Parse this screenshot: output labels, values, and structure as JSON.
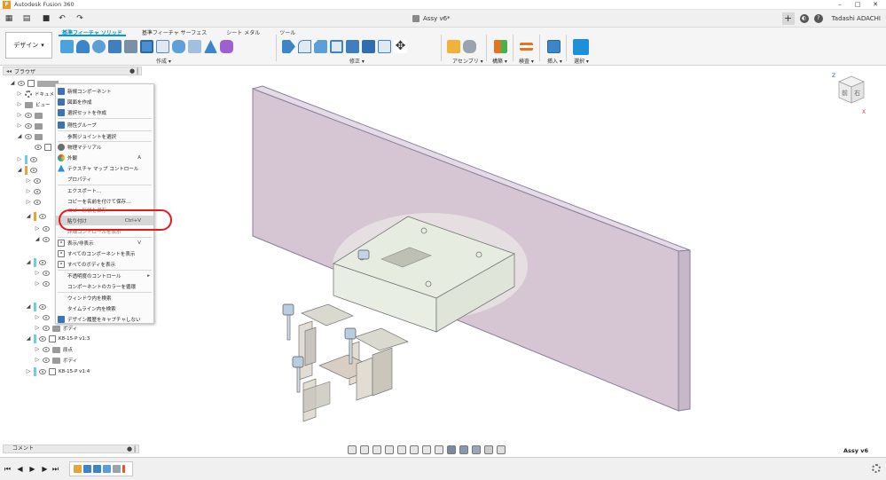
{
  "app": {
    "title": "Autodesk Fusion 360",
    "logo_letter": "F"
  },
  "window_controls": {
    "minimize": "–",
    "maximize": "□",
    "close": "✕"
  },
  "quick_access": {
    "grid_icon": "▦",
    "file_icon": "▤",
    "save_icon": "■",
    "undo_icon": "↶",
    "redo_icon": "↷",
    "document_tab": "Assy v6*",
    "tab_close": "✕",
    "new_tab": "+",
    "user": "Tadashi ADACHI",
    "help_badge": "?",
    "jobs_badge": "◐"
  },
  "toolbar": {
    "workspace": "デザイン",
    "workspace_arrow": "▾",
    "tabs": [
      "基準フィーチャ ソリッド",
      "基準フィーチャ サーフェス",
      "シート メタル",
      "ツール"
    ],
    "groups": {
      "create": "作成 ▾",
      "modify": "修正 ▾",
      "assemble": "アセンブリ ▾",
      "construct": "構築 ▾",
      "inspect": "検査 ▾",
      "insert": "挿入 ▾",
      "select": "選択 ▾"
    }
  },
  "browser": {
    "title": "ブラウザ",
    "arrows": "◂◂",
    "gear": "●",
    "collapse": "|",
    "rows": {
      "r1": "",
      "r2": "ドキュメント",
      "r3": "ビュー",
      "ks1": "K8-15-P v1:3",
      "origin": "原点",
      "body": "ボディ",
      "ks2": "K8-15-P v1:4",
      "body2": "ボディ"
    }
  },
  "context_menu": {
    "items": [
      {
        "label": "新規コンポーネント",
        "shortcut": "",
        "icon_color": "#3b73b9"
      },
      {
        "label": "図面を作成",
        "shortcut": "",
        "icon_color": "#3b73b9"
      },
      {
        "label": "選択セットを作成",
        "shortcut": "",
        "icon_color": "#3b73b9"
      },
      {
        "label": "剛性グループ",
        "shortcut": "",
        "icon_color": "#3b73b9"
      },
      {
        "label": "参照ジョイントを選択",
        "shortcut": "",
        "icon_color": ""
      },
      {
        "label": "物理マテリアル",
        "shortcut": "",
        "icon_color": "#6d6d6d"
      },
      {
        "label": "外観",
        "shortcut": "A",
        "icon_color": "#e05a2b"
      },
      {
        "label": "テクスチャ マップ コントロール",
        "shortcut": "",
        "icon_color": "#2f8ed8"
      },
      {
        "label": "プロパティ",
        "shortcut": "",
        "icon_color": ""
      },
      {
        "label": "エクスポート...",
        "shortcut": "",
        "icon_color": ""
      },
      {
        "label": "コピーを名前を付けて保存...",
        "shortcut": "",
        "icon_color": ""
      },
      {
        "label": "コピー形状を保存",
        "shortcut": "",
        "icon_color": ""
      },
      {
        "label": "貼り付け",
        "shortcut": "Ctrl+V",
        "icon_color": ""
      },
      {
        "label": "詳細コントロールを表示",
        "shortcut": "",
        "icon_color": ""
      },
      {
        "label": "表示/非表示",
        "shortcut": "V",
        "icon_color": "#777777"
      },
      {
        "label": "すべてのコンポーネントを表示",
        "shortcut": "",
        "icon_color": "#777777"
      },
      {
        "label": "すべてのボディを表示",
        "shortcut": "",
        "icon_color": "#777777"
      },
      {
        "label": "不透明度のコントロール",
        "shortcut": "▸",
        "icon_color": ""
      },
      {
        "label": "コンポーネントのカラーを循環",
        "shortcut": "",
        "icon_color": ""
      },
      {
        "label": "ウィンドウ内を検索",
        "shortcut": "",
        "icon_color": ""
      },
      {
        "label": "タイムライン内を検索",
        "shortcut": "",
        "icon_color": ""
      },
      {
        "label": "デザイン履歴をキャプチャしない",
        "shortcut": "",
        "icon_color": "#3b73b9"
      }
    ]
  },
  "comments": {
    "label": "コメント",
    "gear": "●",
    "collapse": "|"
  },
  "viewcube": {
    "front": "前",
    "right": "右",
    "axis_z": "Z",
    "axis_x": "X"
  },
  "document_name": "Assy v6",
  "timeline": {
    "first": "⏮",
    "prev": "◀",
    "play": "▶",
    "next": "▶",
    "last": "⏭"
  },
  "colors": {
    "accent": "#0696d7",
    "plate": "#d9c9d6",
    "highlight_ring": "#e8191b",
    "block": "#e6eee0"
  }
}
